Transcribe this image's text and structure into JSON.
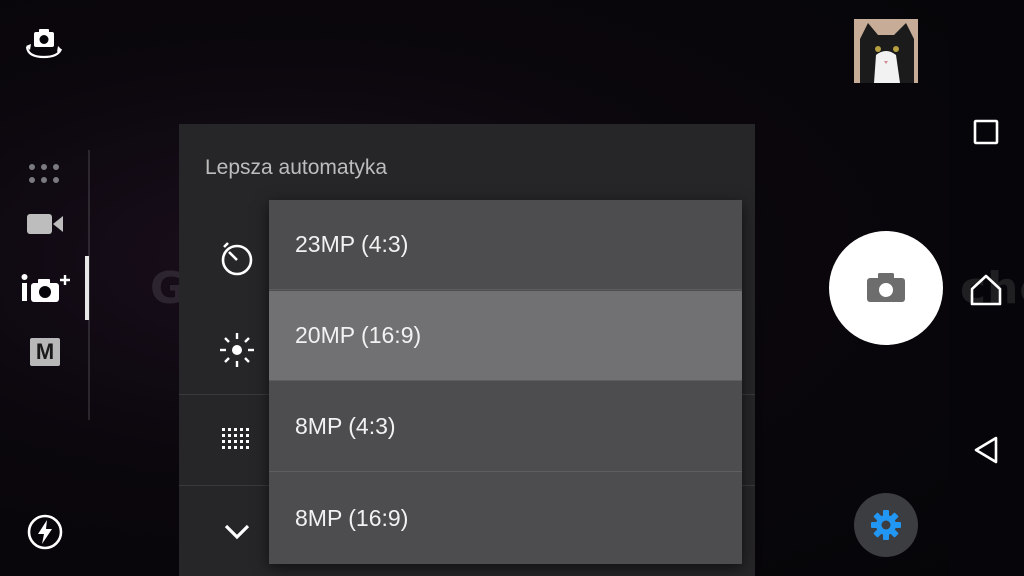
{
  "watermark": {
    "left": "GSMchoice",
    "mid": "mGSM",
    "right": "choice"
  },
  "left_rail": {
    "switch_camera_icon": "switch-camera-icon",
    "modes_icon": "camera-modes-grid-icon",
    "video_icon": "video-mode-icon",
    "superior_auto_icon": "superior-auto-icon",
    "manual_label": "M",
    "flash_icon": "flash-auto-icon"
  },
  "settings_panel": {
    "title": "Lepsza automatyka",
    "rows": [
      {
        "icon": "self-timer-icon"
      },
      {
        "icon": "brightness-icon"
      },
      {
        "icon": "resolution-grid-icon"
      },
      {
        "icon": "chevron-down-icon"
      }
    ]
  },
  "resolution_dropdown": {
    "selected_index": 1,
    "options": [
      "23MP (4:3)",
      "20MP (16:9)",
      "8MP (4:3)",
      "8MP (16:9)"
    ]
  },
  "right_controls": {
    "thumbnail": "last-photo-thumbnail",
    "shutter_icon": "camera-icon",
    "settings_icon": "gear-icon",
    "settings_color": "#2196f3"
  },
  "nav_bar": {
    "recents_icon": "recents-icon",
    "home_icon": "home-icon",
    "back_icon": "back-icon"
  }
}
